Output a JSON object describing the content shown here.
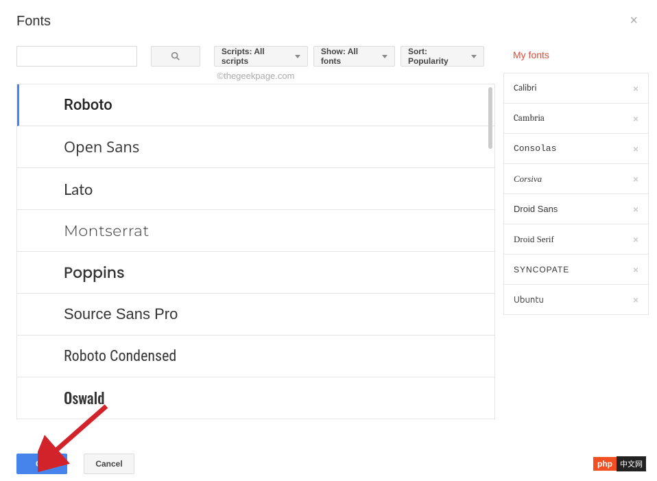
{
  "dialog": {
    "title": "Fonts"
  },
  "filters": {
    "scripts": "Scripts: All scripts",
    "show": "Show: All fonts",
    "sort": "Sort: Popularity"
  },
  "watermark": "©thegeekpage.com",
  "fontList": [
    {
      "name": "Roboto",
      "css": "font-roboto",
      "selected": true
    },
    {
      "name": "Open Sans",
      "css": "font-opensans",
      "selected": false
    },
    {
      "name": "Lato",
      "css": "font-lato",
      "selected": false
    },
    {
      "name": "Montserrat",
      "css": "font-montserrat",
      "selected": false
    },
    {
      "name": "Poppins",
      "css": "font-poppins",
      "selected": false
    },
    {
      "name": "Source Sans Pro",
      "css": "font-sourcesans",
      "selected": false
    },
    {
      "name": "Roboto Condensed",
      "css": "font-robotocond",
      "selected": false
    },
    {
      "name": "Oswald",
      "css": "font-oswald",
      "selected": false
    }
  ],
  "myFontsTitle": "My fonts",
  "myFonts": [
    {
      "name": "Calibri",
      "css": "mf-calibri"
    },
    {
      "name": "Cambria",
      "css": "mf-cambria"
    },
    {
      "name": "Consolas",
      "css": "mf-consolas"
    },
    {
      "name": "Corsiva",
      "css": "mf-corsiva"
    },
    {
      "name": "Droid Sans",
      "css": "mf-droidsans"
    },
    {
      "name": "Droid Serif",
      "css": "mf-droidserif"
    },
    {
      "name": "Syncopate",
      "css": "mf-syncopate"
    },
    {
      "name": "Ubuntu",
      "css": "mf-ubuntu"
    }
  ],
  "buttons": {
    "ok": "OK",
    "cancel": "Cancel"
  },
  "logo": {
    "php": "php",
    "cn": "中文网"
  }
}
